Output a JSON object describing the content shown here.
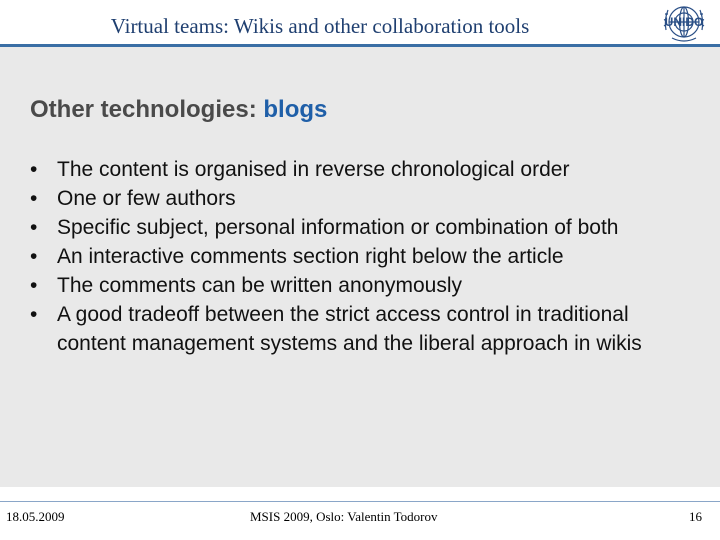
{
  "header": {
    "title": "Virtual teams: Wikis and other collaboration tools",
    "logo_text": "UNIDO"
  },
  "slide": {
    "heading_prefix": "Other technologies: ",
    "heading_accent": "blogs",
    "bullet_symbol": "•",
    "bullets": [
      "The content is organised in reverse chronological order",
      "One or few authors",
      "Specific subject, personal information or combination of both",
      "An interactive comments section right below the article",
      "The comments can be written anonymously",
      "A good tradeoff between the strict access control in traditional content management systems and the liberal approach in wikis"
    ]
  },
  "footer": {
    "date": "18.05.2009",
    "center": "MSIS 2009, Oslo: Valentin Todorov",
    "page": "16"
  },
  "colors": {
    "header_text": "#1f3f70",
    "accent": "#1f5fa8",
    "rule": "#3a6ea5",
    "panel": "#e9e9e9",
    "heading": "#4a4a4a"
  }
}
